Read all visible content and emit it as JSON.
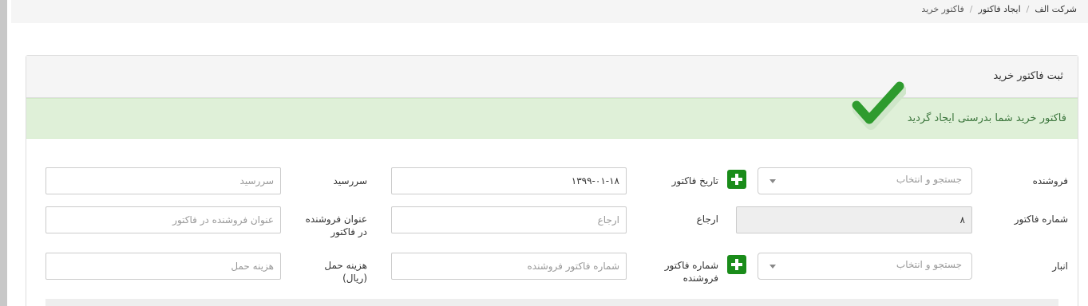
{
  "breadcrumb": {
    "company": "شرکت الف",
    "create_invoice": "ایجاد فاکتور",
    "current": "فاکتور خرید"
  },
  "panel": {
    "title": "ثبت فاکتور خرید"
  },
  "alert": {
    "message": "فاکتور خرید شما بدرستی ایجاد گردید"
  },
  "form": {
    "seller_label": "فروشنده",
    "seller_placeholder": "جستجو و انتخاب",
    "invoice_date_label": "تاریخ فاکتور",
    "invoice_date_value": "۱۳۹۹-۰۱-۱۸",
    "due_label": "سررسید",
    "due_placeholder": "سررسید",
    "invoice_number_label": "شماره فاکتور",
    "invoice_number_value": "۸",
    "reference_label": "ارجاع",
    "reference_placeholder": "ارجاع",
    "seller_title_label": "عنوان فروشنده در فاکتور",
    "seller_title_placeholder": "عنوان فروشنده در فاکتور",
    "warehouse_label": "انبار",
    "warehouse_placeholder": "جستجو و انتخاب",
    "seller_invoice_number_label": "شماره فاکتور فروشنده",
    "seller_invoice_number_placeholder": "شماره فاکتور فروشنده",
    "shipping_cost_label": "هزینه حمل (ریال)",
    "shipping_cost_placeholder": "هزینه حمل"
  },
  "icons": {
    "success": "checkmark-icon",
    "add": "plus-icon"
  },
  "colors": {
    "alert_bg": "#dff0d8",
    "alert_text": "#3c763d",
    "add_button": "#1a8c1a",
    "check_green": "#2e9b2e"
  }
}
